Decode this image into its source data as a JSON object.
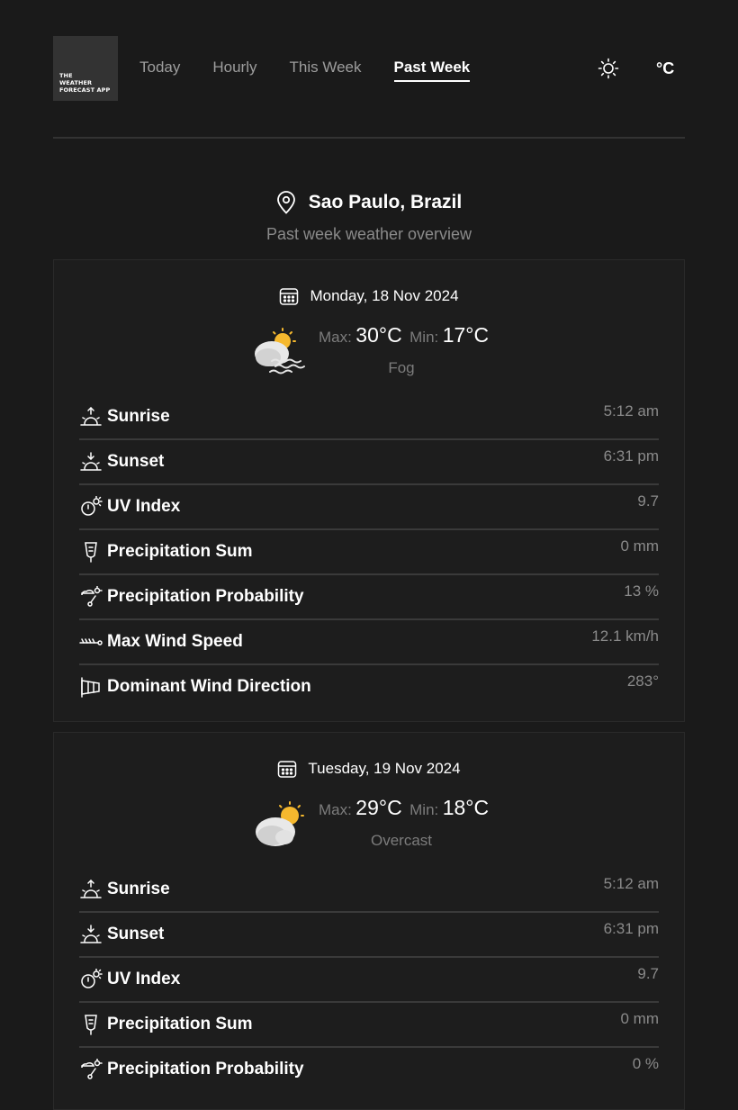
{
  "app": {
    "logo_lines": [
      "THE",
      "WEATHER",
      "FORECAST APP"
    ]
  },
  "nav": {
    "tabs": [
      "Today",
      "Hourly",
      "This Week",
      "Past Week"
    ],
    "active": "Past Week"
  },
  "header": {
    "unit_label": "°C",
    "theme_icon": "sun-icon"
  },
  "location": {
    "name": "Sao Paulo, Brazil",
    "subtitle": "Past week weather overview"
  },
  "labels": {
    "max": "Max:",
    "min": "Min:"
  },
  "days": [
    {
      "date": "Monday, 18 Nov 2024",
      "max": "30°C",
      "min": "17°C",
      "condition": "Fog",
      "icon": "fog-icon",
      "rows": [
        {
          "label": "Sunrise",
          "value": "5:12 am",
          "icon": "sunrise-icon"
        },
        {
          "label": "Sunset",
          "value": "6:31 pm",
          "icon": "sunset-icon"
        },
        {
          "label": "UV Index",
          "value": "9.7",
          "icon": "uv-icon"
        },
        {
          "label": "Precipitation Sum",
          "value": "0 mm",
          "icon": "rain-gauge-icon"
        },
        {
          "label": "Precipitation Probability",
          "value": "13 %",
          "icon": "precip-probability-icon"
        },
        {
          "label": "Max Wind Speed",
          "value": "12.1 km/h",
          "icon": "wind-icon"
        },
        {
          "label": "Dominant Wind Direction",
          "value": "283°",
          "icon": "windsock-icon"
        }
      ]
    },
    {
      "date": "Tuesday, 19 Nov 2024",
      "max": "29°C",
      "min": "18°C",
      "condition": "Overcast",
      "icon": "overcast-icon",
      "rows": [
        {
          "label": "Sunrise",
          "value": "5:12 am",
          "icon": "sunrise-icon"
        },
        {
          "label": "Sunset",
          "value": "6:31 pm",
          "icon": "sunset-icon"
        },
        {
          "label": "UV Index",
          "value": "9.7",
          "icon": "uv-icon"
        },
        {
          "label": "Precipitation Sum",
          "value": "0 mm",
          "icon": "rain-gauge-icon"
        },
        {
          "label": "Precipitation Probability",
          "value": "0 %",
          "icon": "precip-probability-icon"
        }
      ]
    }
  ]
}
